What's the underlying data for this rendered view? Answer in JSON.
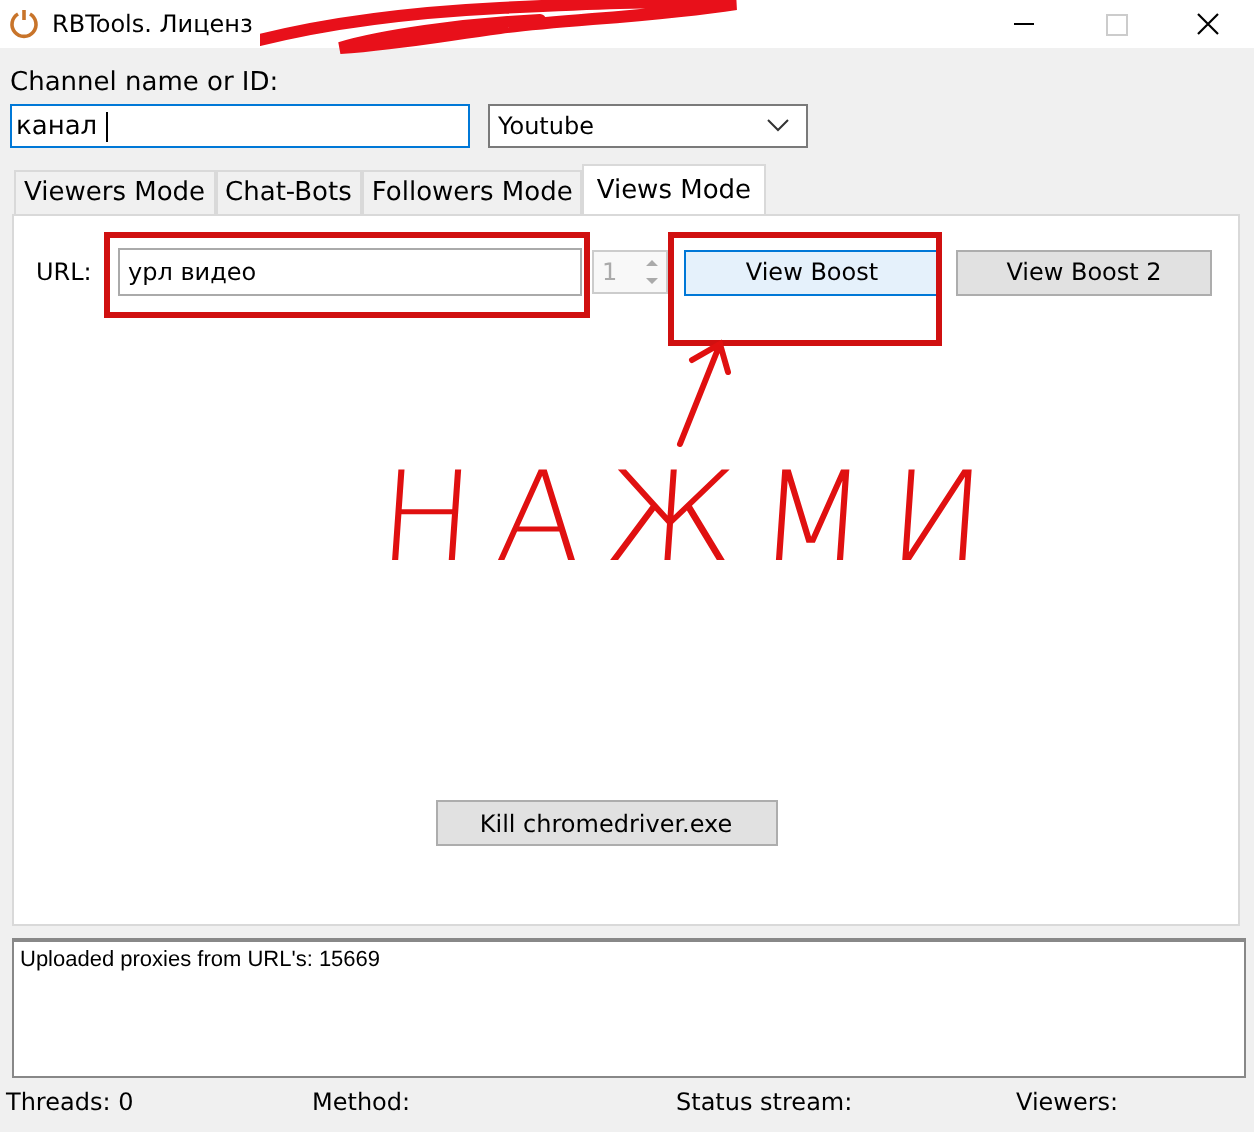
{
  "window": {
    "title": "RBTools. Лиценз"
  },
  "channel": {
    "label": "Channel name or ID:",
    "value": "канал",
    "platform": "Youtube"
  },
  "tabs": [
    {
      "label": "Viewers Mode",
      "selected": false
    },
    {
      "label": "Chat-Bots",
      "selected": false
    },
    {
      "label": "Followers Mode",
      "selected": false
    },
    {
      "label": "Views Mode",
      "selected": true
    }
  ],
  "views": {
    "url_label": "URL:",
    "url_value": "урл видео",
    "count": "1",
    "count_disabled": true,
    "buttons": [
      {
        "label": "View Boost",
        "selected": true
      },
      {
        "label": "View Boost 2",
        "selected": false
      }
    ],
    "kill_button": "Kill chromedriver.exe"
  },
  "log": [
    "Uploaded proxies from URL's: 15669"
  ],
  "status_bar": [
    "Threads: 0",
    "Method:",
    "Status stream:",
    "Viewers:"
  ],
  "annotation": {
    "text": "НАЖМИ"
  }
}
